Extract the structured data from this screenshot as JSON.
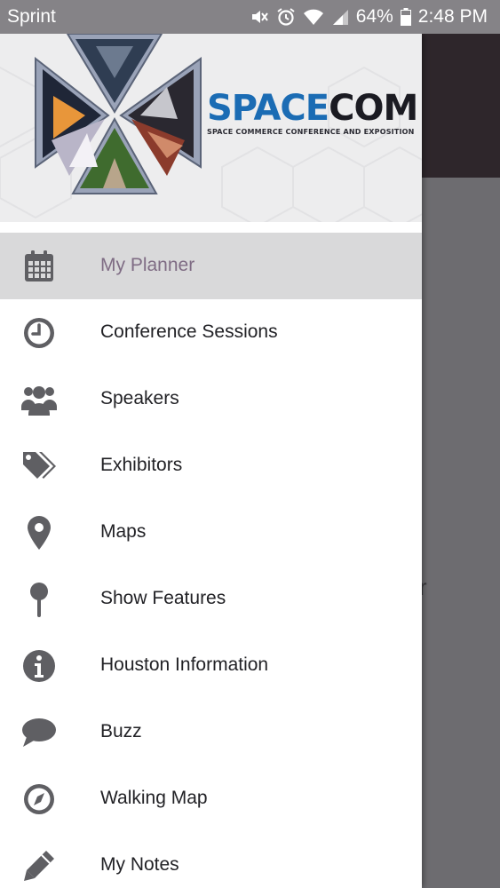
{
  "status_bar": {
    "carrier": "Sprint",
    "battery": "64%",
    "time": "2:48 PM"
  },
  "background": {
    "partial_text": "r"
  },
  "drawer": {
    "brand": {
      "title_part1": "SPACE",
      "title_part2": "COM",
      "tagline": "SPACE COMMERCE CONFERENCE AND EXPOSITION"
    },
    "menu": [
      {
        "label": "My Planner",
        "icon": "calendar-icon",
        "active": true
      },
      {
        "label": "Conference Sessions",
        "icon": "clock-icon",
        "active": false
      },
      {
        "label": "Speakers",
        "icon": "people-icon",
        "active": false
      },
      {
        "label": "Exhibitors",
        "icon": "tags-icon",
        "active": false
      },
      {
        "label": "Maps",
        "icon": "map-marker-icon",
        "active": false
      },
      {
        "label": "Show Features",
        "icon": "pushpin-icon",
        "active": false
      },
      {
        "label": "Houston Information",
        "icon": "info-icon",
        "active": false
      },
      {
        "label": "Buzz",
        "icon": "chat-bubble-icon",
        "active": false
      },
      {
        "label": "Walking Map",
        "icon": "compass-icon",
        "active": false
      },
      {
        "label": "My Notes",
        "icon": "pencil-icon",
        "active": false
      }
    ]
  },
  "colors": {
    "status_bar": "#858387",
    "active_item_bg": "#d9d9da",
    "active_item_text": "#7f6c84",
    "icon_gray": "#5f5f63",
    "brand_blue": "#1b6cb4",
    "overlay": "#6d6c70",
    "bg_app_bar": "#2e262b"
  }
}
